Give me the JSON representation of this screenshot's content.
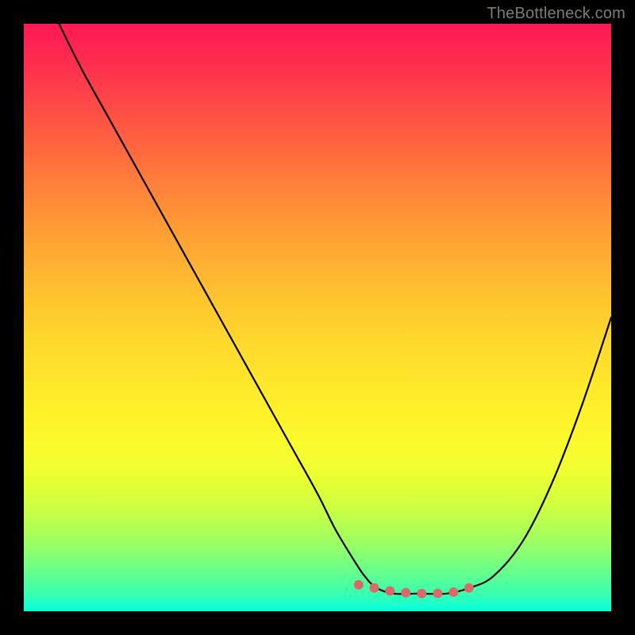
{
  "watermark": "TheBottleneck.com",
  "chart_data": {
    "type": "line",
    "title": "",
    "xlabel": "",
    "ylabel": "",
    "xlim": [
      0,
      100
    ],
    "ylim": [
      0,
      100
    ],
    "background_gradient": {
      "orientation": "vertical",
      "stops": [
        {
          "pos": 0,
          "color": "#ff1954"
        },
        {
          "pos": 50,
          "color": "#ffd22c"
        },
        {
          "pos": 80,
          "color": "#e6ff33"
        },
        {
          "pos": 100,
          "color": "#00ffe0"
        }
      ]
    },
    "series": [
      {
        "name": "bottleneck-curve",
        "color": "#000000",
        "x": [
          6,
          10,
          15,
          20,
          25,
          30,
          35,
          40,
          45,
          50,
          53,
          56,
          58,
          60,
          63,
          67,
          72,
          76,
          80,
          85,
          90,
          95,
          100
        ],
        "y": [
          100,
          92,
          83,
          74,
          65,
          56,
          47,
          38,
          29,
          20,
          14,
          9,
          6,
          4,
          3,
          3,
          3,
          4,
          6,
          12,
          22,
          35,
          50
        ]
      }
    ],
    "annotations": [
      {
        "name": "flat-region-markers",
        "type": "dots",
        "color": "#d96a6a",
        "x": [
          57,
          59.5,
          62,
          64.5,
          67,
          70,
          73,
          76
        ],
        "y": [
          4.5,
          4,
          3.5,
          3.2,
          3,
          3,
          3.2,
          4
        ]
      }
    ]
  }
}
